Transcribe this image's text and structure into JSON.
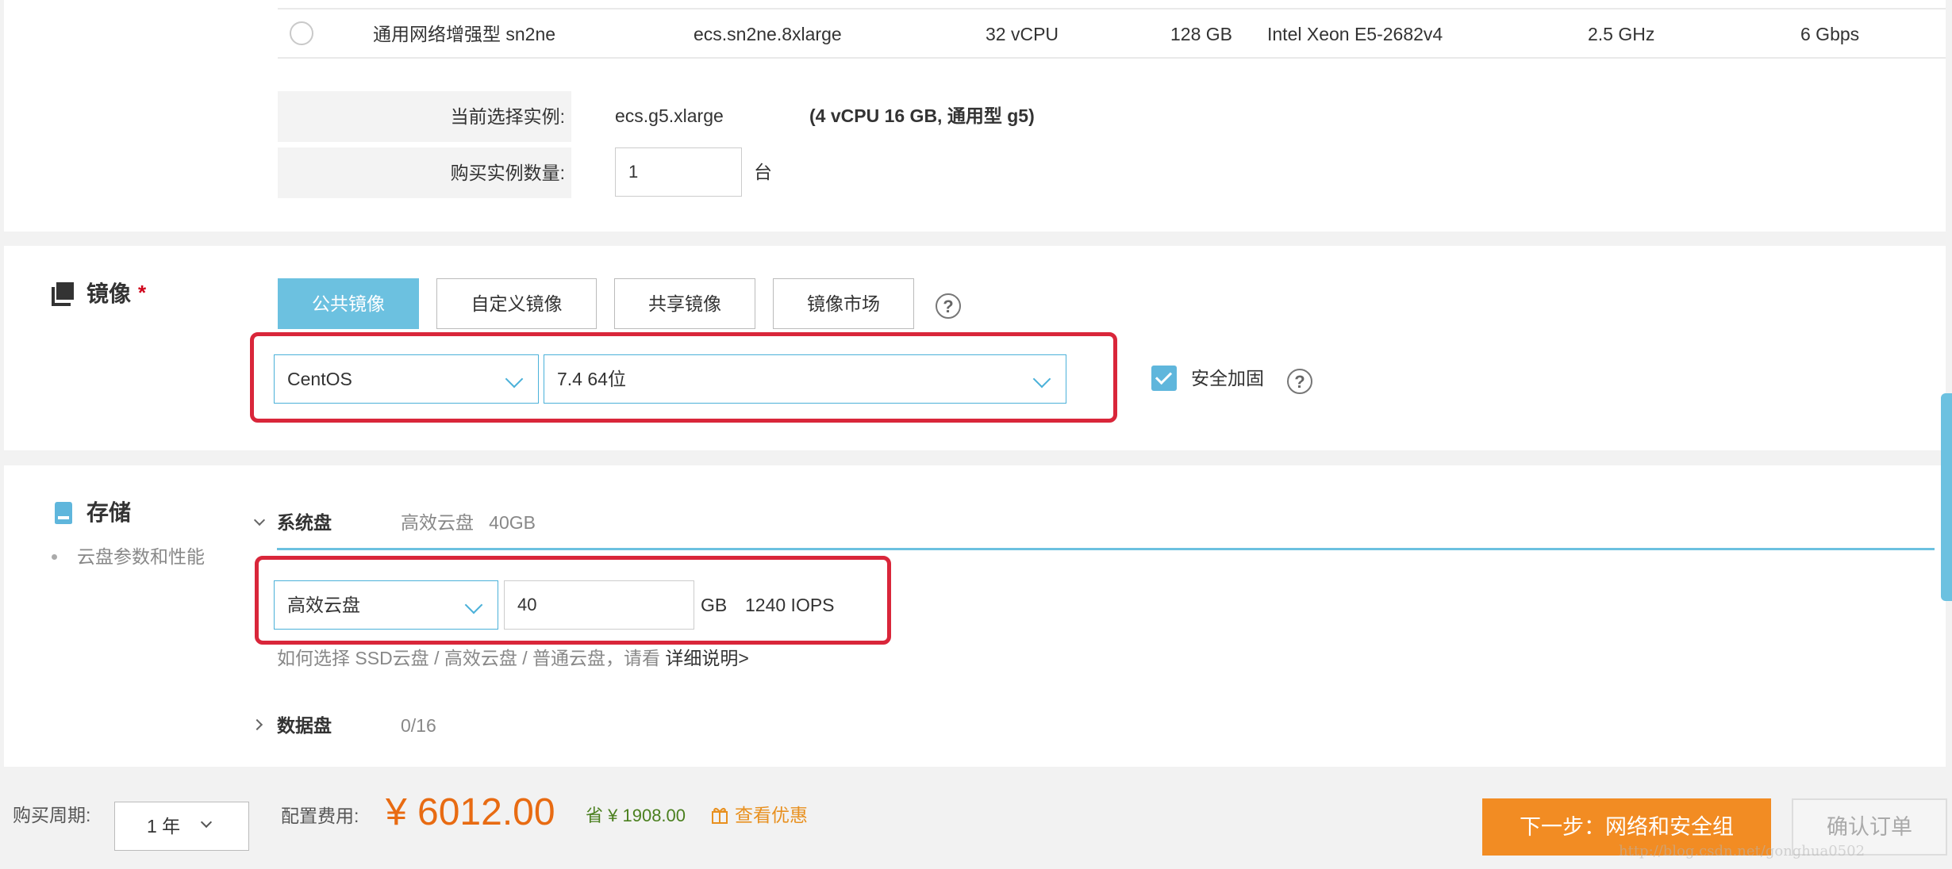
{
  "instance_row": {
    "family": "通用网络增强型 sn2ne",
    "spec": "ecs.sn2ne.8xlarge",
    "vcpu": "32 vCPU",
    "memory": "128 GB",
    "processor": "Intel Xeon E5-2682v4",
    "clock": "2.5 GHz",
    "bandwidth": "6 Gbps"
  },
  "selection": {
    "current_label": "当前选择实例:",
    "current_value": "ecs.g5.xlarge",
    "current_detail": "(4 vCPU 16 GB, 通用型 g5)",
    "quantity_label": "购买实例数量:",
    "quantity_value": "1",
    "quantity_unit": "台"
  },
  "image": {
    "title": "镜像",
    "required_mark": "*",
    "tabs": [
      "公共镜像",
      "自定义镜像",
      "共享镜像",
      "镜像市场"
    ],
    "help_glyph": "?",
    "os_value": "CentOS",
    "version_value": "7.4 64位",
    "security_label": "安全加固"
  },
  "storage": {
    "title": "存储",
    "sub_item": "云盘参数和性能",
    "system_disk_label": "系统盘",
    "system_disk_summary": "高效云盘   40GB",
    "disk_type_value": "高效云盘",
    "disk_size_value": "40",
    "size_unit": "GB",
    "iops": "1240 IOPS",
    "hint_text": "如何选择 SSD云盘 / 高效云盘 / 普通云盘，请看",
    "hint_link": "详细说明>",
    "data_disk_label": "数据盘",
    "data_disk_count": "0/16"
  },
  "footer": {
    "period_label": "购买周期:",
    "period_value": "1 年",
    "fee_label": "配置费用:",
    "price": "¥ 6012.00",
    "save_label": "省 ¥",
    "save_amount": "1908.00",
    "discount_link": "查看优惠",
    "next_button": "下一步：网络和安全组",
    "confirm_button": "确认订单"
  },
  "watermark": "http://blog.csdn.net/gonghua0502",
  "colors": {
    "accent": "#6cc1e0",
    "highlight": "#d9263a",
    "price": "#e86b12",
    "next_button": "#f28c23"
  }
}
